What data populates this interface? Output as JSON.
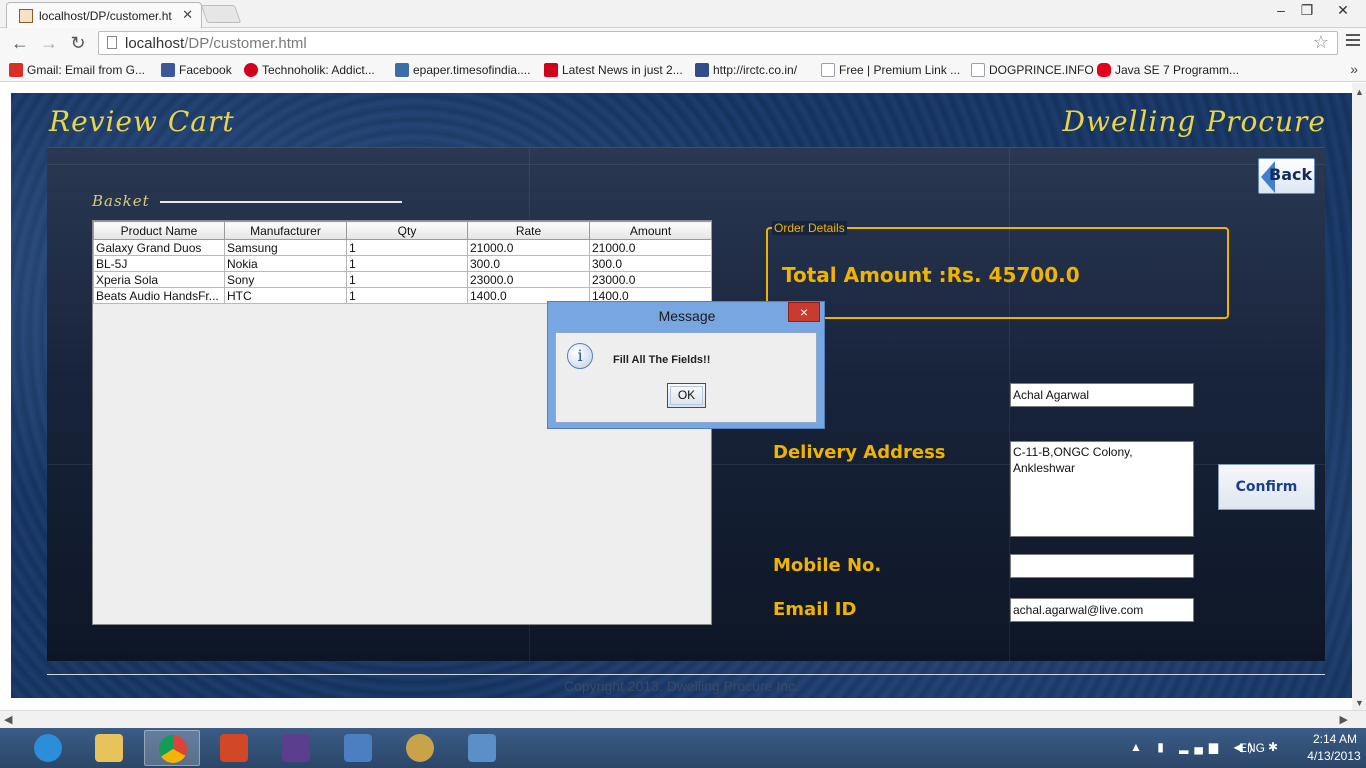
{
  "browser": {
    "tab_title": "localhost/DP/customer.ht",
    "url_host": "localhost",
    "url_path": "/DP/customer.html",
    "bookmarks": [
      {
        "label": "Gmail: Email from G...",
        "icon": "gmail-icon",
        "color": "#d93025"
      },
      {
        "label": "Facebook",
        "icon": "facebook-icon",
        "color": "#3b5998"
      },
      {
        "label": "Technoholik: Addict...",
        "icon": "technoholik-icon",
        "color": "#d0021b"
      },
      {
        "label": "epaper.timesofindia....",
        "icon": "epaper-icon",
        "color": "#3a6ea5"
      },
      {
        "label": "Latest News in just 2...",
        "icon": "toi-icon",
        "color": "#d0021b"
      },
      {
        "label": "http://irctc.co.in/",
        "icon": "irctc-icon",
        "color": "#334c8c"
      },
      {
        "label": "Free | Premium Link ...",
        "icon": "page-icon",
        "color": "#9aa0a6"
      },
      {
        "label": "DOGPRINCE.INFO",
        "icon": "page-icon",
        "color": "#9aa0a6"
      },
      {
        "label": "Java SE 7 Programm...",
        "icon": "oracle-icon",
        "color": "#e2001a"
      }
    ],
    "more": "»"
  },
  "app": {
    "title_left": "Review Cart",
    "title_right": "Dwelling Procure",
    "back_label": "Back",
    "basket_label": "Basket",
    "table": {
      "columns": [
        "Product Name",
        "Manufacturer",
        "Qty",
        "Rate",
        "Amount"
      ],
      "rows": [
        [
          "Galaxy Grand Duos",
          "Samsung",
          "1",
          "21000.0",
          "21000.0"
        ],
        [
          "BL-5J",
          "Nokia",
          "1",
          "300.0",
          "300.0"
        ],
        [
          "Xperia Sola",
          "Sony",
          "1",
          "23000.0",
          "23000.0"
        ],
        [
          "Beats Audio HandsFr...",
          "HTC",
          "1",
          "1400.0",
          "1400.0"
        ]
      ]
    },
    "order_details_legend": "Order Details",
    "total_amount": "Total Amount :Rs. 45700.0",
    "form": {
      "name_value": "Achal Agarwal",
      "address_label": "Delivery Address",
      "address_value": "C-11-B,ONGC Colony,\nAnkleshwar",
      "mobile_label": "Mobile No.",
      "mobile_value": "",
      "email_label": "Email ID",
      "email_value": "achal.agarwal@live.com"
    },
    "confirm_label": "Confirm",
    "footer": "Copyright 2013. Dwelling Procure Inc."
  },
  "dialog": {
    "title": "Message",
    "close": "×",
    "icon": "info-icon",
    "message": "Fill All The Fields!!",
    "ok_label": "OK"
  },
  "taskbar": {
    "apps": [
      {
        "name": "internet-explorer-icon",
        "color": "#2a8fd8"
      },
      {
        "name": "file-explorer-icon",
        "color": "#e8c25a"
      },
      {
        "name": "chrome-icon",
        "color": "#3d9b3f"
      },
      {
        "name": "powerpoint-icon",
        "color": "#d24726"
      },
      {
        "name": "java-ee-ide-icon",
        "color": "#5b3e8e"
      },
      {
        "name": "installer-icon",
        "color": "#4a7fc1"
      },
      {
        "name": "paint-icon",
        "color": "#c9a34a"
      },
      {
        "name": "photo-viewer-icon",
        "color": "#5a8fc7"
      }
    ],
    "active_index": 2,
    "language": "ENG",
    "time": "2:14 AM",
    "date": "4/13/2013"
  }
}
